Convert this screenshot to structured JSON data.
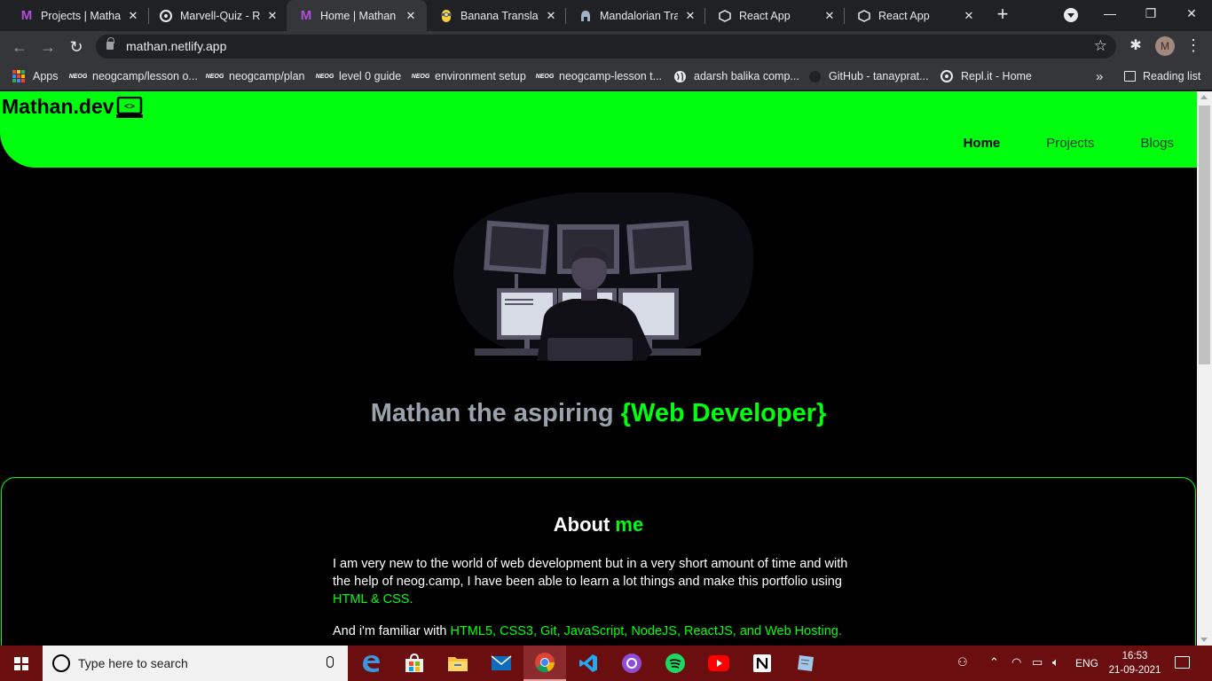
{
  "browser": {
    "tabs": [
      {
        "title": "Projects | Mathan",
        "icon": "letter-m",
        "active": false
      },
      {
        "title": "Marvell-Quiz - Re",
        "icon": "replit",
        "active": false
      },
      {
        "title": "Home | Mathan",
        "icon": "letter-m",
        "active": true
      },
      {
        "title": "Banana Translatio",
        "icon": "minion",
        "active": false
      },
      {
        "title": "Mandalorian Tran",
        "icon": "helmet",
        "active": false
      },
      {
        "title": "React App",
        "icon": "codesandbox",
        "active": false
      },
      {
        "title": "React App",
        "icon": "codesandbox",
        "active": false
      }
    ],
    "url": "mathan.netlify.app",
    "profile_initial": "M",
    "bookmarks": [
      {
        "label": "Apps",
        "icon": "apps-grid"
      },
      {
        "label": "neogcamp/lesson o...",
        "icon": "neog"
      },
      {
        "label": "neogcamp/plan",
        "icon": "neog"
      },
      {
        "label": "level 0 guide",
        "icon": "neog"
      },
      {
        "label": "environment setup",
        "icon": "neog"
      },
      {
        "label": "neogcamp-lesson t...",
        "icon": "neog"
      },
      {
        "label": "adarsh balika comp...",
        "icon": "globe"
      },
      {
        "label": "GitHub - tanayprat...",
        "icon": "github"
      },
      {
        "label": "Repl.it - Home",
        "icon": "replit"
      }
    ],
    "bookmarks_overflow": "»",
    "reading_list": "Reading list",
    "neog_badge": "NEOG"
  },
  "site": {
    "logo_text": "Mathan.dev",
    "logo_symbol": "<>",
    "nav": [
      {
        "label": "Home",
        "active": true
      },
      {
        "label": "Projects",
        "active": false
      },
      {
        "label": "Blogs",
        "active": false
      }
    ],
    "tagline_prefix": "Mathan the aspiring ",
    "tagline_highlight": "{Web Developer}",
    "about": {
      "title_word": "About ",
      "title_highlight": "me",
      "para1_text": "I am very new to the world of web development but in a very short amount of time and with the help of neog.camp, I have been able to learn a lot things and make this portfolio using ",
      "para1_highlight": "HTML & CSS.",
      "para2_text": "And i'm familiar with ",
      "para2_highlight": "HTML5, CSS3, Git, JavaScript, NodeJS, ReactJS, and Web Hosting."
    },
    "colors": {
      "accent": "#00ff0f",
      "background": "#000000",
      "tagline_grey": "#9aa3ad"
    }
  },
  "taskbar": {
    "search_placeholder": "Type here to search",
    "apps": [
      "edge",
      "store",
      "file-explorer",
      "mail",
      "chrome",
      "vscode",
      "github-desktop",
      "spotify",
      "youtube",
      "notion",
      "sticky-notes"
    ],
    "language": "ENG",
    "time": "16:53",
    "date": "21-09-2021",
    "color": "#6b0e10"
  }
}
